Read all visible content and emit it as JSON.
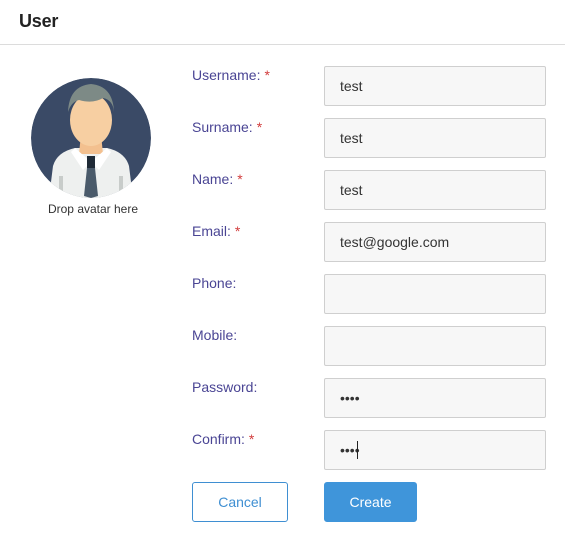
{
  "header": {
    "title": "User"
  },
  "avatar": {
    "caption": "Drop avatar here",
    "icon": "person-avatar-icon"
  },
  "form": {
    "username": {
      "label": "Username:",
      "required": "*",
      "value": "test"
    },
    "surname": {
      "label": "Surname:",
      "required": "*",
      "value": "test"
    },
    "name": {
      "label": "Name:",
      "required": "*",
      "value": "test"
    },
    "email": {
      "label": "Email:",
      "required": "*",
      "value": "test@google.com"
    },
    "phone": {
      "label": "Phone:",
      "value": ""
    },
    "mobile": {
      "label": "Mobile:",
      "value": ""
    },
    "password": {
      "label": "Password:",
      "value": "test"
    },
    "confirm": {
      "label": "Confirm:",
      "required": "*",
      "value": "test"
    }
  },
  "buttons": {
    "cancel": "Cancel",
    "create": "Create"
  },
  "colors": {
    "label": "#4a4594",
    "required": "#d23c3c",
    "primary": "#3f95da",
    "field_bg": "#f7f7f7"
  }
}
